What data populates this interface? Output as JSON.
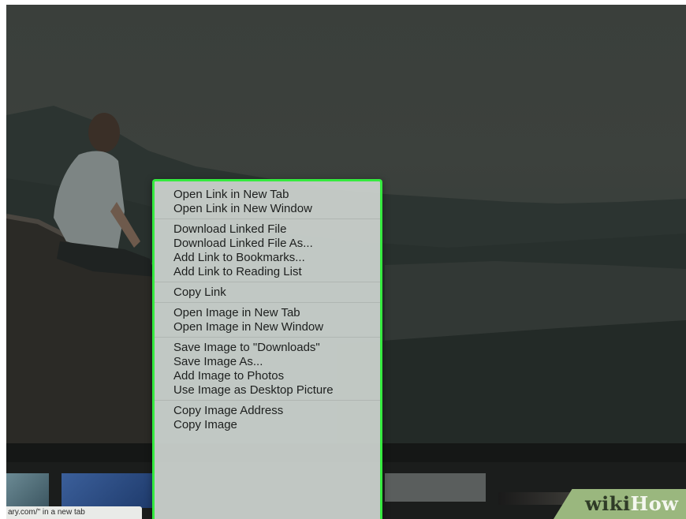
{
  "status_bar": {
    "text": "ary.com/\" in a new tab"
  },
  "watermark": {
    "part1": "wiki",
    "part2": "How"
  },
  "context_menu": {
    "groups": [
      {
        "items": [
          "Open Link in New Tab",
          "Open Link in New Window"
        ]
      },
      {
        "items": [
          "Download Linked File",
          "Download Linked File As...",
          "Add Link to Bookmarks...",
          "Add Link to Reading List"
        ]
      },
      {
        "items": [
          "Copy Link"
        ]
      },
      {
        "items": [
          "Open Image in New Tab",
          "Open Image in New Window"
        ]
      },
      {
        "items": [
          "Save Image to \"Downloads\"",
          "Save Image As...",
          "Add Image to Photos",
          "Use Image as Desktop Picture"
        ]
      },
      {
        "items": [
          "Copy Image Address",
          "Copy Image"
        ]
      }
    ]
  },
  "colors": {
    "highlight_border": "#35ea3f",
    "watermark_bg": "#9ab77e"
  }
}
